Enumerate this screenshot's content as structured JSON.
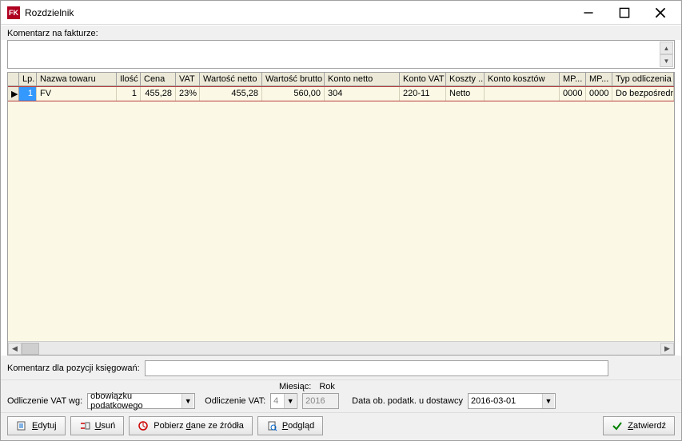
{
  "window": {
    "title": "Rozdzielnik"
  },
  "labels": {
    "komentarz_faktura": "Komentarz na fakturze:",
    "komentarz_pozycji": "Komentarz dla pozycji księgowań:",
    "odliczenie_wg": "Odliczenie VAT wg:",
    "odliczenie_vat": "Odliczenie VAT:",
    "miesiac": "Miesiąc:",
    "rok": "Rok",
    "data_dostawcy": "Data ob. podatk. u dostawcy"
  },
  "grid": {
    "columns": [
      "Lp.",
      "Nazwa towaru",
      "Ilość",
      "Cena",
      "VAT",
      "Wartość netto",
      "Wartość brutto",
      "Konto netto",
      "Konto VAT",
      "Koszty ...",
      "Konto kosztów",
      "MP...",
      "MP...",
      "Typ odliczenia ..."
    ],
    "rows": [
      {
        "lp": "1",
        "nazwa": "FV",
        "ilosc": "1",
        "cena": "455,28",
        "vat": "23%",
        "wnetto": "455,28",
        "wbrutto": "560,00",
        "knetto": "304",
        "kvat": "220-11",
        "koszty": "Netto",
        "kk": "",
        "mp1": "0000",
        "mp2": "0000",
        "typ": "Do bezpośrednie..."
      }
    ]
  },
  "filters": {
    "odliczenie_wg_val": "obowiązku podatkowego",
    "odliczenie_vat_val": "4",
    "rok_val": "2016",
    "data_dostawcy_val": "2016-03-01"
  },
  "buttons": {
    "edytuj": "Edytuj",
    "usun": "Usuń",
    "pobierz": "Pobierz dane ze źródła",
    "podglad": "Podgląd",
    "zatwierdz": "Zatwierdź"
  },
  "inputs": {
    "komentarz_pozycji_val": ""
  }
}
